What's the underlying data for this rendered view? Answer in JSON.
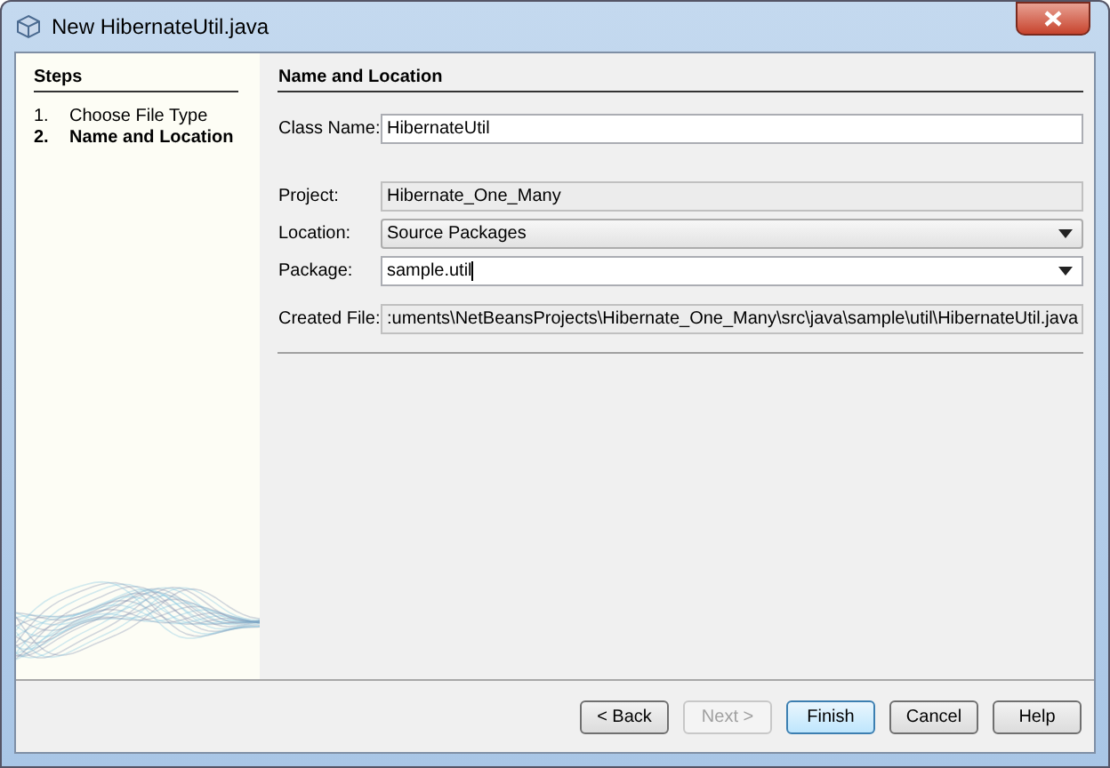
{
  "window": {
    "title": "New HibernateUtil.java"
  },
  "steps": {
    "title": "Steps",
    "items": [
      {
        "number": "1.",
        "label": "Choose File Type",
        "selected": false
      },
      {
        "number": "2.",
        "label": "Name and Location",
        "selected": true
      }
    ]
  },
  "panel": {
    "title": "Name and Location",
    "groups": [
      [
        {
          "kind": "text",
          "label": "Class Name:",
          "value": "HibernateUtil"
        }
      ],
      [
        {
          "kind": "readonly",
          "label": "Project:",
          "value": "Hibernate_One_Many"
        },
        {
          "kind": "combo",
          "label": "Location:",
          "value": "Source Packages"
        },
        {
          "kind": "editable-combo",
          "label": "Package:",
          "value": "sample.util"
        },
        {
          "kind": "readonly",
          "label": "Created File:",
          "value": ":uments\\NetBeansProjects\\Hibernate_One_Many\\src\\java\\sample\\util\\HibernateUtil.java"
        }
      ]
    ]
  },
  "buttons": [
    {
      "label": "< Back",
      "disabled": false,
      "default": false
    },
    {
      "label": "Next >",
      "disabled": true,
      "default": false
    },
    {
      "label": "Finish",
      "disabled": false,
      "default": true
    },
    {
      "label": "Cancel",
      "disabled": false,
      "default": false
    },
    {
      "label": "Help",
      "disabled": false,
      "default": false
    }
  ]
}
